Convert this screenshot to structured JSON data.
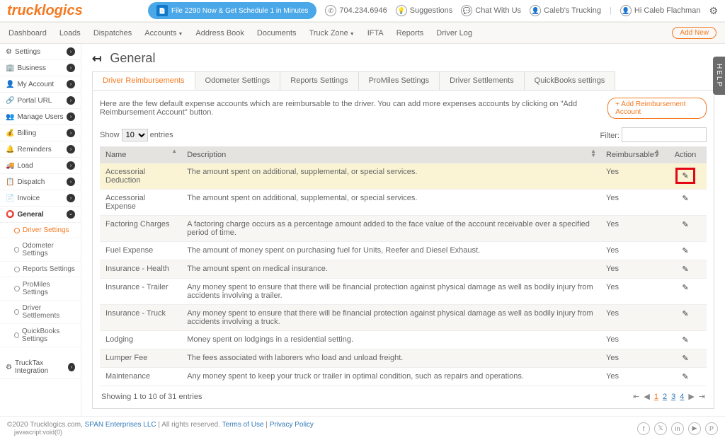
{
  "top": {
    "logo": "trucklogics",
    "file_btn": "File 2290 Now & Get Schedule 1 in Minutes",
    "phone": "704.234.6946",
    "suggestions": "Suggestions",
    "chat": "Chat With Us",
    "company": "Caleb's Trucking",
    "greeting": "Hi Caleb Flachman"
  },
  "nav": [
    "Dashboard",
    "Loads",
    "Dispatches",
    "Accounts",
    "Address Book",
    "Documents",
    "Truck Zone",
    "IFTA",
    "Reports",
    "Driver Log"
  ],
  "nav_dropdown": {
    "Accounts": true,
    "Truck Zone": true
  },
  "add_new": "Add New",
  "sidebar": [
    {
      "icon": "⚙",
      "label": "Settings"
    },
    {
      "icon": "🏢",
      "label": "Business"
    },
    {
      "icon": "👤",
      "label": "My Account"
    },
    {
      "icon": "🔗",
      "label": "Portal URL"
    },
    {
      "icon": "👥",
      "label": "Manage Users"
    },
    {
      "icon": "💰",
      "label": "Billing"
    },
    {
      "icon": "🔔",
      "label": "Reminders"
    },
    {
      "icon": "🚚",
      "label": "Load"
    },
    {
      "icon": "📋",
      "label": "Dispatch"
    },
    {
      "icon": "📄",
      "label": "Invoice"
    },
    {
      "icon": "⭕",
      "label": "General",
      "active": true
    }
  ],
  "subs": [
    {
      "label": "Driver Settings",
      "active": true
    },
    {
      "label": "Odometer Settings"
    },
    {
      "label": "Reports Settings"
    },
    {
      "label": "ProMiles Settings"
    },
    {
      "label": "Driver Settlements"
    },
    {
      "label": "QuickBooks Settings"
    }
  ],
  "trucktax": "TruckTax Integration",
  "page_title": "General",
  "tabs": [
    "Driver Reimbursements",
    "Odometer Settings",
    "Reports Settings",
    "ProMiles Settings",
    "Driver Settlements",
    "QuickBooks settings"
  ],
  "intro": "Here are the few default expense accounts which are reimbursable to the driver. You can add more expenses accounts by clicking on \"Add Reimbursement Account\" button.",
  "add_btn": "+ Add Reimbursement Account",
  "show_label": "Show",
  "entries_label": "entries",
  "page_size": "10",
  "filter_label": "Filter:",
  "columns": [
    "Name",
    "Description",
    "Reimbursable?",
    "Action"
  ],
  "rows": [
    {
      "name": "Accessorial Deduction",
      "desc": "The amount spent on additional, supplemental, or special services.",
      "reimb": "Yes",
      "hl": true
    },
    {
      "name": "Accessorial Expense",
      "desc": "The amount spent on additional, supplemental, or special services.",
      "reimb": "Yes"
    },
    {
      "name": "Factoring Charges",
      "desc": "A factoring charge occurs as a percentage amount added to the face value of the account receivable over a specified period of time.",
      "reimb": "Yes",
      "alt": true
    },
    {
      "name": "Fuel Expense",
      "desc": "The amount of money spent on purchasing fuel for Units, Reefer and Diesel Exhaust.",
      "reimb": "Yes"
    },
    {
      "name": "Insurance - Health",
      "desc": "The amount spent on medical insurance.",
      "reimb": "Yes",
      "alt": true
    },
    {
      "name": "Insurance - Trailer",
      "desc": "Any money spent to ensure that there will be financial protection against physical damage as well as bodily injury from accidents involving a trailer.",
      "reimb": "Yes"
    },
    {
      "name": "Insurance - Truck",
      "desc": "Any money spent to ensure that there will be financial protection against physical damage as well as bodily injury from accidents involving a truck.",
      "reimb": "Yes",
      "alt": true
    },
    {
      "name": "Lodging",
      "desc": "Money spent on lodgings in a residential setting.",
      "reimb": "Yes"
    },
    {
      "name": "Lumper Fee",
      "desc": "The fees associated with laborers who load and unload freight.",
      "reimb": "Yes",
      "alt": true
    },
    {
      "name": "Maintenance",
      "desc": "Any money spent to keep your truck or trailer in optimal condition, such as repairs and operations.",
      "reimb": "Yes"
    }
  ],
  "table_info": "Showing 1 to 10 of 31 entries",
  "pages": [
    "1",
    "2",
    "3",
    "4"
  ],
  "footer": {
    "copyright": "©2020 Trucklogics.com, ",
    "span_link": "SPAN Enterprises LLC",
    "rights": " | All rights reserved. ",
    "terms": "Terms of Use",
    "privacy": "Privacy Policy",
    "js": "javascript:void(0)"
  },
  "help": "HELP"
}
